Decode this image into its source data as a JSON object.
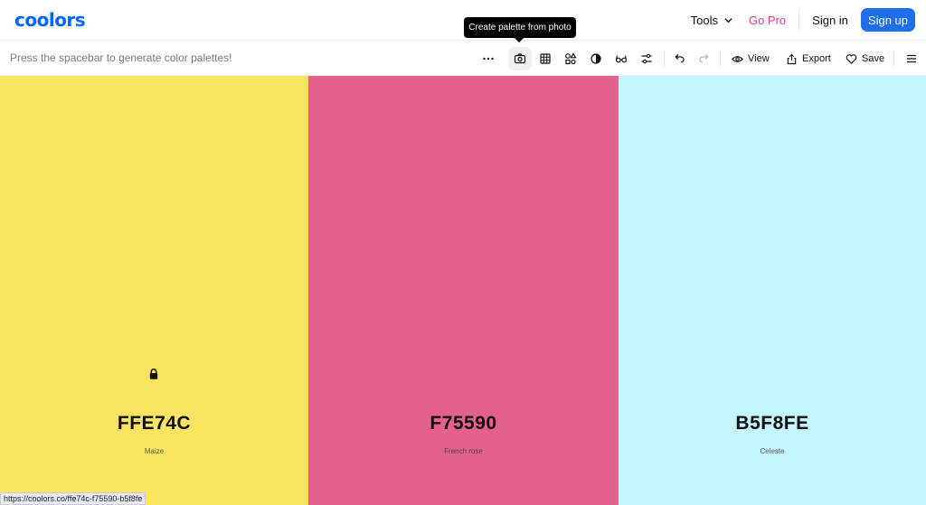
{
  "nav": {
    "logo": "coolors",
    "tools": "Tools",
    "go_pro": "Go Pro",
    "sign_in": "Sign in",
    "sign_up": "Sign up"
  },
  "tooltip": "Create palette from photo",
  "toolbar": {
    "hint": "Press the spacebar to generate color palettes!",
    "icons": [
      "more-icon",
      "camera-icon",
      "grid-icon",
      "shapes-icon",
      "contrast-icon",
      "glasses-icon",
      "sliders-icon",
      "undo-icon",
      "redo-icon"
    ],
    "view": "View",
    "export": "Export",
    "save": "Save"
  },
  "palette": [
    {
      "hex": "FFE74C",
      "name": "Maize",
      "color": "#fbe461",
      "locked": true
    },
    {
      "hex": "F75590",
      "name": "French rose",
      "color": "#e4608f",
      "locked": false
    },
    {
      "hex": "B5F8FE",
      "name": "Celeste",
      "color": "#c5f5fc",
      "locked": false
    }
  ],
  "status_url": "https://coolors.co/ffe74c-f75590-b5f8fe"
}
